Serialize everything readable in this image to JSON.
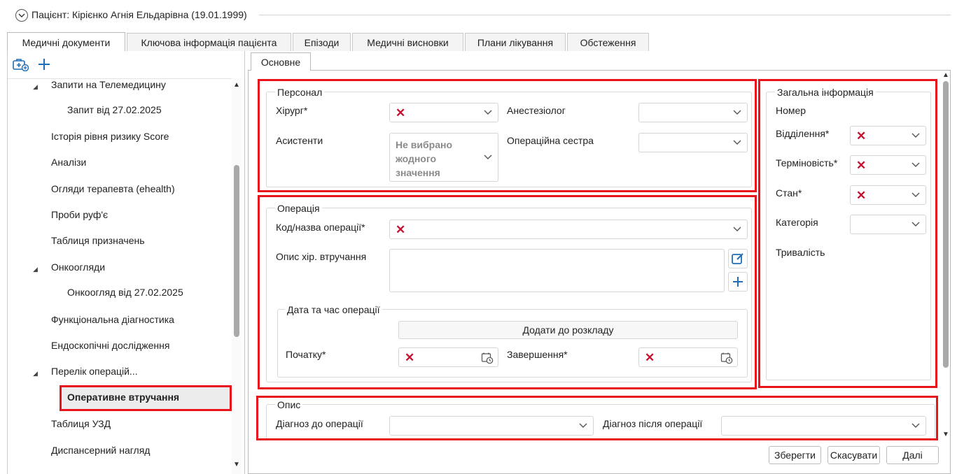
{
  "patient": {
    "title": "Пацієнт: Кірієнко Агнія Ельдарівна (19.01.1999)"
  },
  "tabs": [
    {
      "label": "Медичні документи",
      "active": true
    },
    {
      "label": "Ключова інформація пацієнта",
      "active": false
    },
    {
      "label": "Епізоди",
      "active": false
    },
    {
      "label": "Медичні висновки",
      "active": false
    },
    {
      "label": "Плани лікування",
      "active": false
    },
    {
      "label": "Обстеження",
      "active": false
    }
  ],
  "tree": {
    "items": [
      {
        "label": "Запити на Телемедицину",
        "level": 0,
        "expanded": true
      },
      {
        "label": "Запит від 27.02.2025",
        "level": 1
      },
      {
        "label": "Історія рівня ризику Score",
        "level": 0
      },
      {
        "label": "Аналізи",
        "level": 0
      },
      {
        "label": "Огляди терапевта (ehealth)",
        "level": 0
      },
      {
        "label": "Проби руф'є",
        "level": 0
      },
      {
        "label": "Таблиця призначень",
        "level": 0
      },
      {
        "label": "Онкоогляди",
        "level": 0,
        "expanded": true
      },
      {
        "label": "Онкоогляд від 27.02.2025",
        "level": 1
      },
      {
        "label": "Функціональна діагностика",
        "level": 0
      },
      {
        "label": "Ендоскопічні дослідження",
        "level": 0
      },
      {
        "label": "Перелік операцій...",
        "level": 0,
        "expanded": true
      },
      {
        "label": "Оперативне втручання",
        "level": 1,
        "selected": true
      },
      {
        "label": "Таблиця УЗД",
        "level": 0
      },
      {
        "label": "Диспансерний нагляд",
        "level": 0
      }
    ]
  },
  "subtab": {
    "label": "Основне"
  },
  "personal": {
    "title": "Персонал",
    "surgeon_label": "Хірург*",
    "anesthesiologist_label": "Анестезіолог",
    "assistants_label": "Асистенти",
    "assistants_placeholder": "Не вибрано жодного значення",
    "nurse_label": "Операційна сестра"
  },
  "general": {
    "title": "Загальна інформація",
    "number_label": "Номер",
    "department_label": "Відділення*",
    "urgency_label": "Терміновість*",
    "state_label": "Стан*",
    "category_label": "Категорія",
    "duration_label": "Тривалість"
  },
  "operation": {
    "title": "Операція",
    "code_label": "Код/назва операції*",
    "description_label": "Опис хір. втручання",
    "datetime_title": "Дата та час операції",
    "schedule_button": "Додати до розкладу",
    "start_label": "Початку*",
    "end_label": "Завершення*"
  },
  "description": {
    "title": "Опис",
    "diag_before_label": "Діагноз до операції",
    "diag_after_label": "Діагноз після операції"
  },
  "footer": {
    "save": "Зберегти",
    "cancel": "Скасувати",
    "next": "Далі"
  },
  "colors": {
    "highlight": "#e8141b",
    "invalid_mark": "#c8102e",
    "icon_blue": "#1f6fb8"
  }
}
